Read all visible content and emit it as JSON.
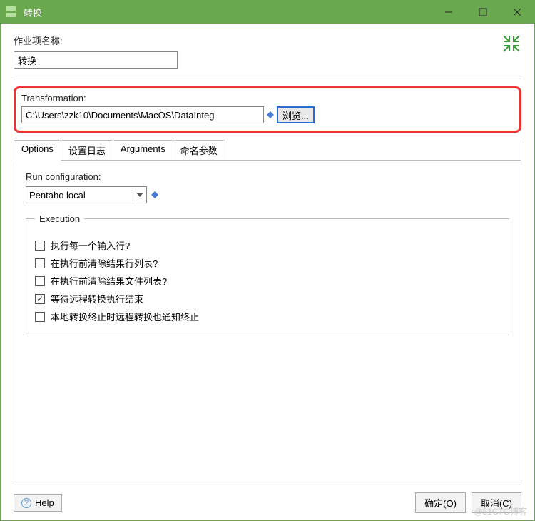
{
  "window": {
    "title": "转换"
  },
  "job": {
    "label": "作业项名称:",
    "value": "转换"
  },
  "transformation": {
    "label": "Transformation:",
    "path": "C:\\Users\\zzk10\\Documents\\MacOS\\DataInteg",
    "browse": "浏览..."
  },
  "tabs": {
    "options": "Options",
    "log": "设置日志",
    "arguments": "Arguments",
    "params": "命名参数"
  },
  "runConfig": {
    "label": "Run configuration:",
    "value": "Pentaho local"
  },
  "execution": {
    "legend": "Execution",
    "items": [
      {
        "label": "执行每一个输入行?",
        "checked": false
      },
      {
        "label": "在执行前清除结果行列表?",
        "checked": false
      },
      {
        "label": "在执行前清除结果文件列表?",
        "checked": false
      },
      {
        "label": "等待远程转换执行结束",
        "checked": true
      },
      {
        "label": "本地转换终止时远程转换也通知终止",
        "checked": false
      }
    ]
  },
  "footer": {
    "help": "Help",
    "ok": "确定(O)",
    "cancel": "取消(C)"
  },
  "watermark": "@51CTO博客"
}
